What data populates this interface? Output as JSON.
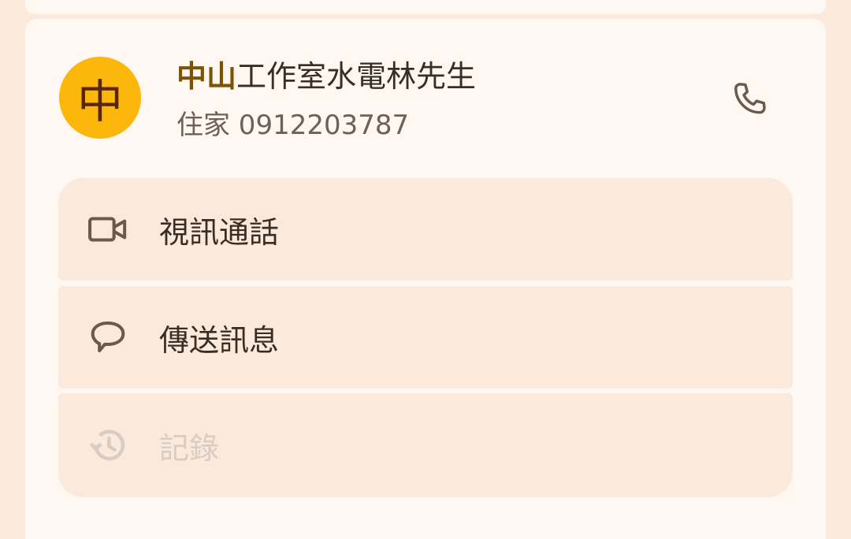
{
  "contact": {
    "avatar_letter": "中",
    "name_highlight": "中山",
    "name_rest": "工作室水電林先生",
    "subtitle": "住家 0912203787"
  },
  "actions": [
    {
      "label": "視訊通話",
      "icon": "video-camera-icon"
    },
    {
      "label": "傳送訊息",
      "icon": "message-bubble-icon"
    },
    {
      "label": "記錄",
      "icon": "history-icon"
    }
  ],
  "colors": {
    "background": "#fbe9dc",
    "card": "#fff7f1",
    "avatar": "#fbb80b",
    "highlight": "#7d5200",
    "icon": "#6a5a4c",
    "disabled": "#d8ccc4"
  }
}
